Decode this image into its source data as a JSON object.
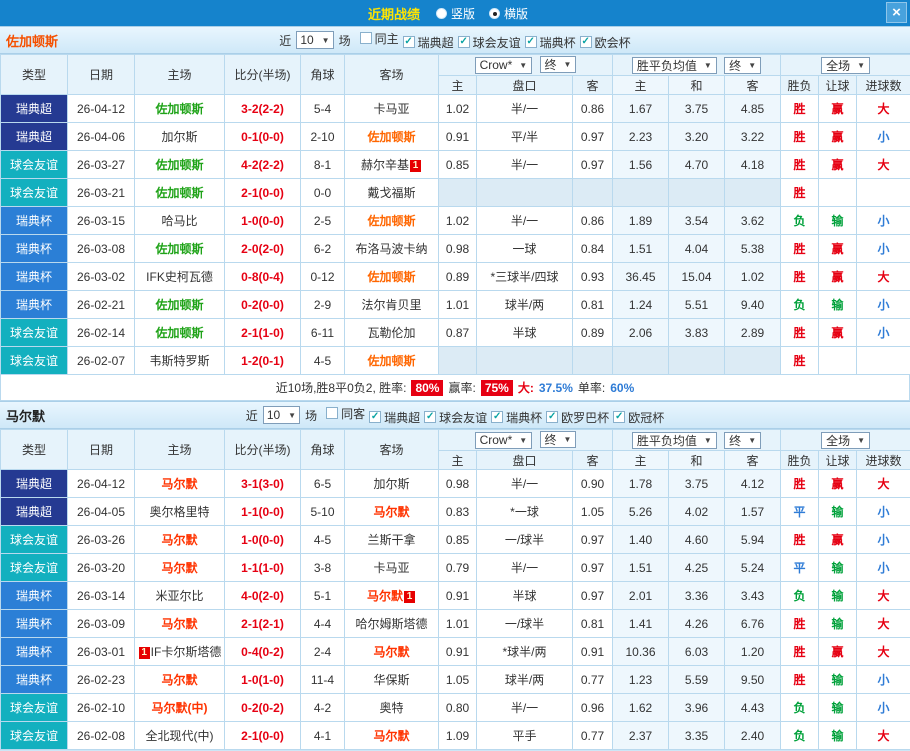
{
  "titlebar": {
    "title": "近期战绩",
    "radios": [
      {
        "label": "竖版",
        "selected": false
      },
      {
        "label": "横版",
        "selected": true
      }
    ],
    "close": "×"
  },
  "sections": [
    {
      "team": "佐加顿斯",
      "filter": {
        "near_label": "近",
        "count": "10",
        "games_label": "场",
        "checkboxes": [
          {
            "label": "同主",
            "checked": false
          },
          {
            "label": "瑞典超",
            "checked": true
          },
          {
            "label": "球会友谊",
            "checked": true
          },
          {
            "label": "瑞典杯",
            "checked": true
          },
          {
            "label": "欧会杯",
            "checked": true
          }
        ]
      },
      "dropdowns": {
        "company": "Crow*",
        "company_state": "终",
        "avg": "胜平负均值",
        "avg_state": "终",
        "scope": "全场"
      },
      "headers": {
        "type": "类型",
        "date": "日期",
        "home": "主场",
        "score": "比分(半场)",
        "corner": "角球",
        "away": "客场",
        "h": "主",
        "handicap": "盘口",
        "a": "客",
        "avg_h": "主",
        "avg_d": "和",
        "avg_a": "客",
        "result": "胜负",
        "let_result": "让球",
        "goals": "进球数"
      },
      "rows": [
        {
          "league": "瑞典超",
          "lg": "super",
          "date": "26-04-12",
          "home": "佐加顿斯",
          "home_c": "green",
          "score": "3-2(2-2)",
          "corner": "5-4",
          "away": "卡马亚",
          "away_c": "black",
          "oh": "1.02",
          "hcp": "半/一",
          "oa": "0.86",
          "ah": "1.67",
          "ad": "3.75",
          "aa": "4.85",
          "res": "胜",
          "res_c": "win",
          "rang": "赢",
          "rang_c": "win",
          "goal": "大",
          "goal_c": "big"
        },
        {
          "league": "瑞典超",
          "lg": "super",
          "date": "26-04-06",
          "home": "加尔斯",
          "home_c": "black",
          "score": "0-1(0-0)",
          "corner": "2-10",
          "away": "佐加顿斯",
          "away_c": "orange",
          "oh": "0.91",
          "hcp": "平/半",
          "oa": "0.97",
          "ah": "2.23",
          "ad": "3.20",
          "aa": "3.22",
          "res": "胜",
          "res_c": "win",
          "rang": "赢",
          "rang_c": "win",
          "goal": "小",
          "goal_c": "small"
        },
        {
          "league": "球会友谊",
          "lg": "friendly",
          "date": "26-03-27",
          "home": "佐加顿斯",
          "home_c": "green",
          "score": "4-2(2-2)",
          "corner": "8-1",
          "away": "赫尔辛基",
          "away_c": "black",
          "away_badge": "1",
          "oh": "0.85",
          "hcp": "半/一",
          "oa": "0.97",
          "ah": "1.56",
          "ad": "4.70",
          "aa": "4.18",
          "res": "胜",
          "res_c": "win",
          "rang": "赢",
          "rang_c": "win",
          "goal": "大",
          "goal_c": "big"
        },
        {
          "league": "球会友谊",
          "lg": "friendly",
          "date": "26-03-21",
          "home": "佐加顿斯",
          "home_c": "green",
          "score": "2-1(0-0)",
          "corner": "0-0",
          "away": "戴戈福斯",
          "away_c": "black",
          "oh": "",
          "hcp": "",
          "oa": "",
          "ah": "",
          "ad": "",
          "aa": "",
          "res": "胜",
          "res_c": "win",
          "rang": "",
          "rang_c": "",
          "goal": "",
          "goal_c": ""
        },
        {
          "league": "瑞典杯",
          "lg": "cup",
          "date": "26-03-15",
          "home": "哈马比",
          "home_c": "black",
          "score": "1-0(0-0)",
          "corner": "2-5",
          "away": "佐加顿斯",
          "away_c": "orange",
          "oh": "1.02",
          "hcp": "半/一",
          "oa": "0.86",
          "ah": "1.89",
          "ad": "3.54",
          "aa": "3.62",
          "res": "负",
          "res_c": "lose",
          "rang": "输",
          "rang_c": "lose",
          "goal": "小",
          "goal_c": "small"
        },
        {
          "league": "瑞典杯",
          "lg": "cup",
          "date": "26-03-08",
          "home": "佐加顿斯",
          "home_c": "green",
          "score": "2-0(2-0)",
          "corner": "6-2",
          "away": "布洛马波卡纳",
          "away_c": "black",
          "oh": "0.98",
          "hcp": "一球",
          "oa": "0.84",
          "ah": "1.51",
          "ad": "4.04",
          "aa": "5.38",
          "res": "胜",
          "res_c": "win",
          "rang": "赢",
          "rang_c": "win",
          "goal": "小",
          "goal_c": "small"
        },
        {
          "league": "瑞典杯",
          "lg": "cup",
          "date": "26-03-02",
          "home": "IFK史柯瓦德",
          "home_c": "black",
          "score": "0-8(0-4)",
          "corner": "0-12",
          "away": "佐加顿斯",
          "away_c": "orange",
          "oh": "0.89",
          "hcp": "*三球半/四球",
          "oa": "0.93",
          "ah": "36.45",
          "ad": "15.04",
          "aa": "1.02",
          "res": "胜",
          "res_c": "win",
          "rang": "赢",
          "rang_c": "win",
          "goal": "大",
          "goal_c": "big"
        },
        {
          "league": "瑞典杯",
          "lg": "cup",
          "date": "26-02-21",
          "home": "佐加顿斯",
          "home_c": "green",
          "score": "0-2(0-0)",
          "corner": "2-9",
          "away": "法尔肯贝里",
          "away_c": "black",
          "oh": "1.01",
          "hcp": "球半/两",
          "oa": "0.81",
          "ah": "1.24",
          "ad": "5.51",
          "aa": "9.40",
          "res": "负",
          "res_c": "lose",
          "rang": "输",
          "rang_c": "lose",
          "goal": "小",
          "goal_c": "small"
        },
        {
          "league": "球会友谊",
          "lg": "friendly",
          "date": "26-02-14",
          "home": "佐加顿斯",
          "home_c": "green",
          "score": "2-1(1-0)",
          "corner": "6-11",
          "away": "瓦勒伦加",
          "away_c": "black",
          "oh": "0.87",
          "hcp": "半球",
          "oa": "0.89",
          "ah": "2.06",
          "ad": "3.83",
          "aa": "2.89",
          "res": "胜",
          "res_c": "win",
          "rang": "赢",
          "rang_c": "win",
          "goal": "小",
          "goal_c": "small"
        },
        {
          "league": "球会友谊",
          "lg": "friendly",
          "date": "26-02-07",
          "home": "韦斯特罗斯",
          "home_c": "black",
          "score": "1-2(0-1)",
          "corner": "4-5",
          "away": "佐加顿斯",
          "away_c": "orange",
          "oh": "",
          "hcp": "",
          "oa": "",
          "ah": "",
          "ad": "",
          "aa": "",
          "res": "胜",
          "res_c": "win",
          "rang": "",
          "rang_c": "",
          "goal": "",
          "goal_c": ""
        }
      ],
      "summary": {
        "prefix": "近10场,胜8平0负2, 胜率:",
        "win_rate": "80%",
        "let_label": "赢率:",
        "let_rate": "75%",
        "big_label": "大:",
        "big_value": "37.5%",
        "single_label": "单率:",
        "single_value": "60%"
      }
    },
    {
      "team": "马尔默",
      "filter": {
        "near_label": "近",
        "count": "10",
        "games_label": "场",
        "checkboxes": [
          {
            "label": "同客",
            "checked": false
          },
          {
            "label": "瑞典超",
            "checked": true
          },
          {
            "label": "球会友谊",
            "checked": true
          },
          {
            "label": "瑞典杯",
            "checked": true
          },
          {
            "label": "欧罗巴杯",
            "checked": true
          },
          {
            "label": "欧冠杯",
            "checked": true
          }
        ]
      },
      "dropdowns": {
        "company": "Crow*",
        "company_state": "终",
        "avg": "胜平负均值",
        "avg_state": "终",
        "scope": "全场"
      },
      "headers": {
        "type": "类型",
        "date": "日期",
        "home": "主场",
        "score": "比分(半场)",
        "corner": "角球",
        "away": "客场",
        "h": "主",
        "handicap": "盘口",
        "a": "客",
        "avg_h": "主",
        "avg_d": "和",
        "avg_a": "客",
        "result": "胜负",
        "let_result": "让球",
        "goals": "进球数"
      },
      "rows": [
        {
          "league": "瑞典超",
          "lg": "super",
          "date": "26-04-12",
          "home": "马尔默",
          "home_c": "red",
          "score": "3-1(3-0)",
          "corner": "6-5",
          "away": "加尔斯",
          "away_c": "black",
          "oh": "0.98",
          "hcp": "半/一",
          "oa": "0.90",
          "ah": "1.78",
          "ad": "3.75",
          "aa": "4.12",
          "res": "胜",
          "res_c": "win",
          "rang": "赢",
          "rang_c": "win",
          "goal": "大",
          "goal_c": "big"
        },
        {
          "league": "瑞典超",
          "lg": "super",
          "date": "26-04-05",
          "home": "奥尔格里特",
          "home_c": "black",
          "score": "1-1(0-0)",
          "corner": "5-10",
          "away": "马尔默",
          "away_c": "red",
          "oh": "0.83",
          "hcp": "*一球",
          "oa": "1.05",
          "ah": "5.26",
          "ad": "4.02",
          "aa": "1.57",
          "res": "平",
          "res_c": "draw",
          "rang": "输",
          "rang_c": "lose",
          "goal": "小",
          "goal_c": "small"
        },
        {
          "league": "球会友谊",
          "lg": "friendly",
          "date": "26-03-26",
          "home": "马尔默",
          "home_c": "red",
          "score": "1-0(0-0)",
          "corner": "4-5",
          "away": "兰斯干拿",
          "away_c": "black",
          "oh": "0.85",
          "hcp": "一/球半",
          "oa": "0.97",
          "ah": "1.40",
          "ad": "4.60",
          "aa": "5.94",
          "res": "胜",
          "res_c": "win",
          "rang": "赢",
          "rang_c": "win",
          "goal": "小",
          "goal_c": "small"
        },
        {
          "league": "球会友谊",
          "lg": "friendly",
          "date": "26-03-20",
          "home": "马尔默",
          "home_c": "red",
          "score": "1-1(1-0)",
          "corner": "3-8",
          "away": "卡马亚",
          "away_c": "black",
          "oh": "0.79",
          "hcp": "半/一",
          "oa": "0.97",
          "ah": "1.51",
          "ad": "4.25",
          "aa": "5.24",
          "res": "平",
          "res_c": "draw",
          "rang": "输",
          "rang_c": "lose",
          "goal": "小",
          "goal_c": "small"
        },
        {
          "league": "瑞典杯",
          "lg": "cup",
          "date": "26-03-14",
          "home": "米亚尔比",
          "home_c": "black",
          "score": "4-0(2-0)",
          "corner": "5-1",
          "away": "马尔默",
          "away_c": "red",
          "away_badge": "1",
          "oh": "0.91",
          "hcp": "半球",
          "oa": "0.97",
          "ah": "2.01",
          "ad": "3.36",
          "aa": "3.43",
          "res": "负",
          "res_c": "lose",
          "rang": "输",
          "rang_c": "lose",
          "goal": "大",
          "goal_c": "big"
        },
        {
          "league": "瑞典杯",
          "lg": "cup",
          "date": "26-03-09",
          "home": "马尔默",
          "home_c": "red",
          "score": "2-1(2-1)",
          "corner": "4-4",
          "away": "哈尔姆斯塔德",
          "away_c": "black",
          "oh": "1.01",
          "hcp": "一/球半",
          "oa": "0.81",
          "ah": "1.41",
          "ad": "4.26",
          "aa": "6.76",
          "res": "胜",
          "res_c": "win",
          "rang": "输",
          "rang_c": "lose",
          "goal": "大",
          "goal_c": "big"
        },
        {
          "league": "瑞典杯",
          "lg": "cup",
          "date": "26-03-01",
          "home": "IF卡尔斯塔德",
          "home_c": "black",
          "home_badge": "1",
          "home_badge_pos": "before",
          "score": "0-4(0-2)",
          "corner": "2-4",
          "away": "马尔默",
          "away_c": "red",
          "oh": "0.91",
          "hcp": "*球半/两",
          "oa": "0.91",
          "ah": "10.36",
          "ad": "6.03",
          "aa": "1.20",
          "res": "胜",
          "res_c": "win",
          "rang": "赢",
          "rang_c": "win",
          "goal": "大",
          "goal_c": "big"
        },
        {
          "league": "瑞典杯",
          "lg": "cup",
          "date": "26-02-23",
          "home": "马尔默",
          "home_c": "red",
          "score": "1-0(1-0)",
          "corner": "11-4",
          "away": "华保斯",
          "away_c": "black",
          "oh": "1.05",
          "hcp": "球半/两",
          "oa": "0.77",
          "ah": "1.23",
          "ad": "5.59",
          "aa": "9.50",
          "res": "胜",
          "res_c": "win",
          "rang": "输",
          "rang_c": "lose",
          "goal": "小",
          "goal_c": "small"
        },
        {
          "league": "球会友谊",
          "lg": "friendly",
          "date": "26-02-10",
          "home": "马尔默(中)",
          "home_c": "red",
          "score": "0-2(0-2)",
          "corner": "4-2",
          "away": "奥特",
          "away_c": "black",
          "oh": "0.80",
          "hcp": "半/一",
          "oa": "0.96",
          "ah": "1.62",
          "ad": "3.96",
          "aa": "4.43",
          "res": "负",
          "res_c": "lose",
          "rang": "输",
          "rang_c": "lose",
          "goal": "小",
          "goal_c": "small"
        },
        {
          "league": "球会友谊",
          "lg": "friendly",
          "date": "26-02-08",
          "home": "全北现代(中)",
          "home_c": "black",
          "score": "2-1(0-0)",
          "corner": "4-1",
          "away": "马尔默",
          "away_c": "red",
          "oh": "1.09",
          "hcp": "平手",
          "oa": "0.77",
          "ah": "2.37",
          "ad": "3.35",
          "aa": "2.40",
          "res": "负",
          "res_c": "lose",
          "rang": "输",
          "rang_c": "lose",
          "goal": "大",
          "goal_c": "big"
        }
      ],
      "summary": null
    }
  ]
}
